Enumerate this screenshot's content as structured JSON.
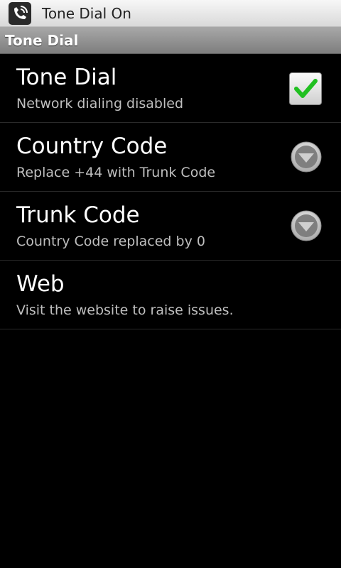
{
  "notification": {
    "title": "Tone Dial On",
    "icon": "phone-signal-icon"
  },
  "title_bar": {
    "title": "Tone Dial"
  },
  "preferences": [
    {
      "title": "Tone Dial",
      "summary": "Network dialing disabled",
      "widget": "checkbox",
      "checked": true,
      "icon": "check-icon",
      "accent": "#21c021"
    },
    {
      "title": "Country Code",
      "summary": "Replace +44 with Trunk Code",
      "widget": "dropdown",
      "icon": "dropdown-arrow-icon"
    },
    {
      "title": "Trunk Code",
      "summary": "Country Code replaced by 0",
      "widget": "dropdown",
      "icon": "dropdown-arrow-icon"
    },
    {
      "title": "Web",
      "summary": "Visit the website to raise issues.",
      "widget": "none"
    }
  ],
  "colors": {
    "background": "#000000",
    "title_text": "#ffffff",
    "summary_text": "#bfbfbf",
    "divider": "#2a2a2a"
  }
}
